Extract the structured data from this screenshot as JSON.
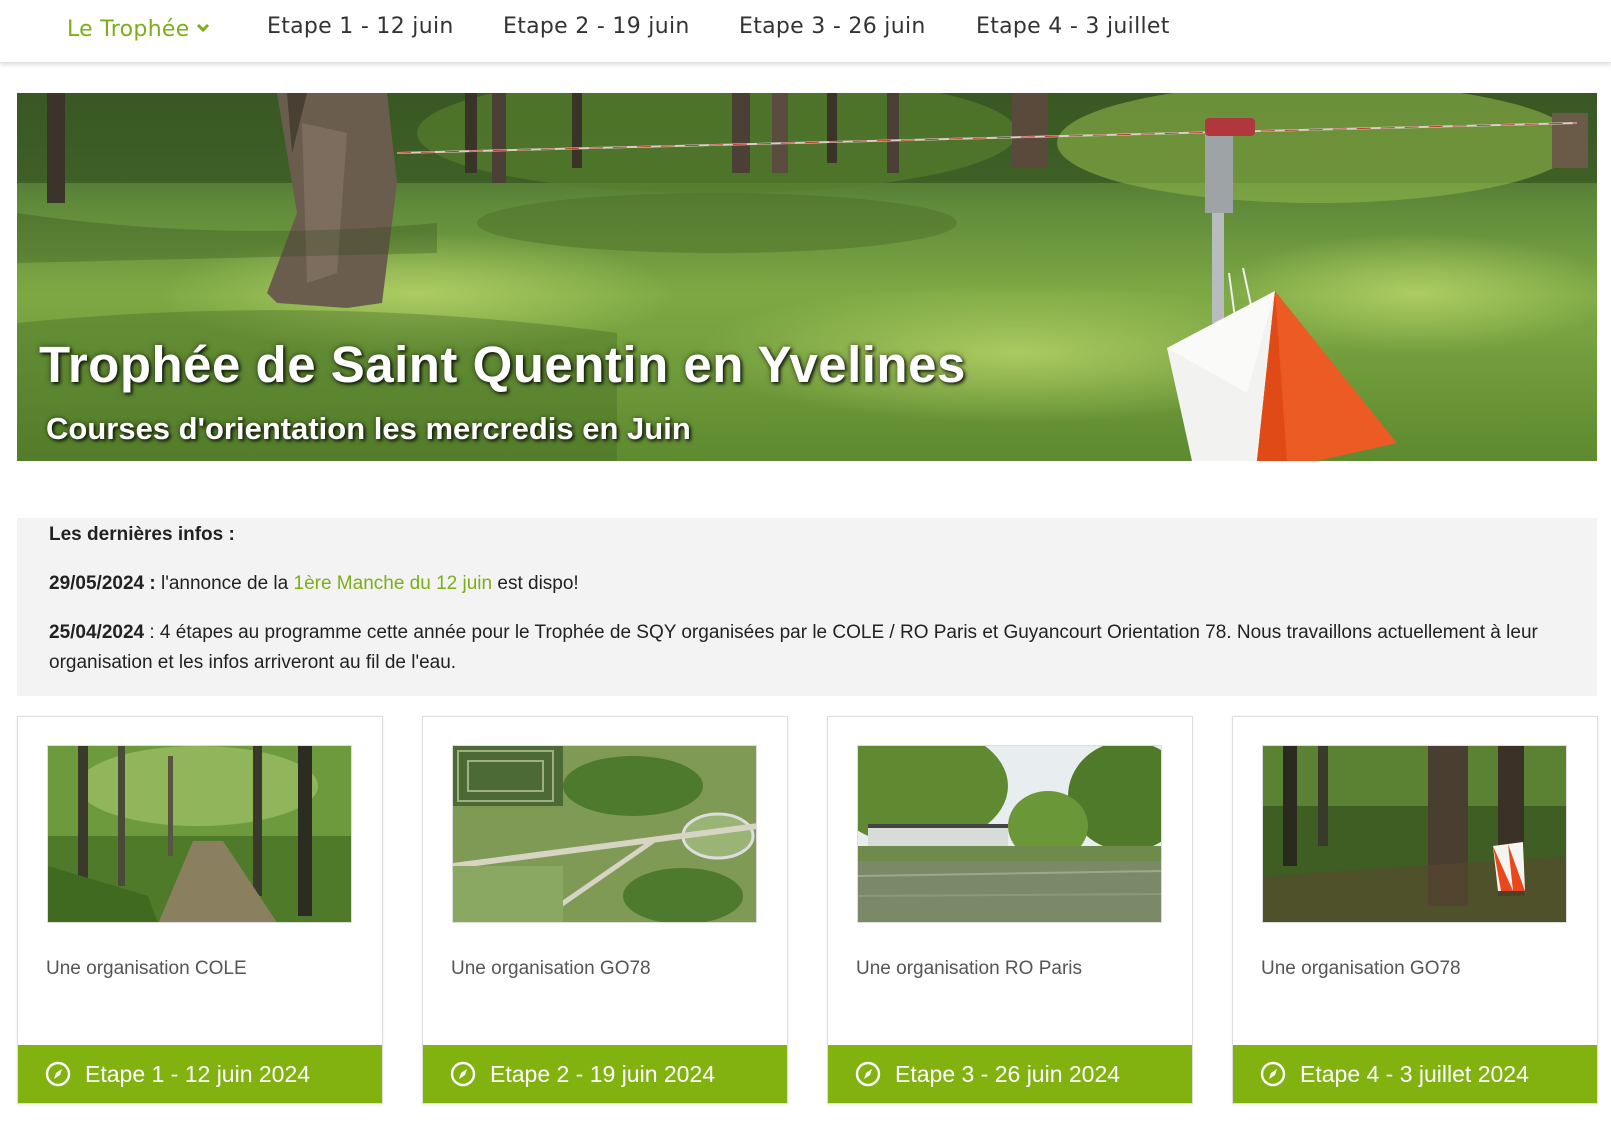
{
  "nav": {
    "items": [
      {
        "label": "Le Trophée",
        "active": true
      },
      {
        "label": "Etape 1 - 12 juin"
      },
      {
        "label": "Etape 2 - 19 juin"
      },
      {
        "label": "Etape 3 - 26 juin"
      },
      {
        "label": "Etape 4 - 3 juillet"
      }
    ],
    "dropdown_icon": "chevron-down-icon"
  },
  "hero": {
    "title": "Trophée de Saint Quentin en Yvelines",
    "subtitle": "Courses d'orientation les mercredis en Juin"
  },
  "info": {
    "heading": "Les dernières infos :",
    "item1": {
      "date": "29/05/2024 :",
      "text_before": " l'annonce de la ",
      "link": "1ère Manche du 12 juin",
      "text_after": " est dispo!"
    },
    "item2": {
      "date": "25/04/2024",
      "text": " : 4 étapes au programme cette année pour le Trophée de SQY organisées par le COLE / RO Paris et Guyancourt Orientation 78. Nous travaillons actuellement à leur organisation et les infos arriveront au fil de l'eau."
    }
  },
  "cards": [
    {
      "org": "Une organisation COLE",
      "button": "Etape 1 - 12 juin 2024"
    },
    {
      "org": "Une organisation GO78",
      "button": "Etape 2 - 19 juin 2024"
    },
    {
      "org": "Une organisation RO Paris",
      "button": "Etape 3 - 26 juin 2024"
    },
    {
      "org": "Une organisation GO78",
      "button": "Etape 4 - 3 juillet 2024"
    }
  ],
  "colors": {
    "accent": "#7cae1a",
    "button": "#82b20f",
    "info_bg": "#f3f3f3"
  },
  "button_icon": "compass-icon"
}
